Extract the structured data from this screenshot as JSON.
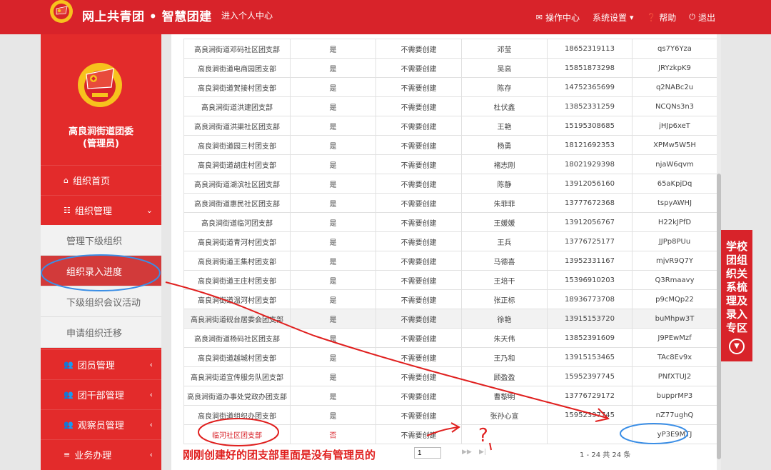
{
  "header": {
    "brand": "网上共青团 • 智慧团建",
    "enter_personal": "进入个人中心",
    "nav": {
      "operation_center": "操作中心",
      "system_settings": "系统设置",
      "help": "帮助",
      "logout": "退出"
    }
  },
  "sidebar": {
    "org_name_line1": "高良涧街道团委",
    "org_name_line2": "(管理员)",
    "items": {
      "home": "组织首页",
      "org_mgmt": "组织管理",
      "sub_manage": "管理下级组织",
      "sub_progress": "组织录入进度",
      "sub_meeting": "下级组织会议活动",
      "sub_migrate": "申请组织迁移",
      "member_mgmt": "团员管理",
      "cadre_mgmt": "团干部管理",
      "observer_mgmt": "观察员管理",
      "business": "业务办理"
    }
  },
  "table": {
    "rows": [
      {
        "org": "高良涧街道邓码社区团支部",
        "flag": "是",
        "status": "不需要创建",
        "name": "邓莹",
        "phone": "18652319113",
        "code": "qs7Y6Yza"
      },
      {
        "org": "高良涧街道电商园团支部",
        "flag": "是",
        "status": "不需要创建",
        "name": "吴高",
        "phone": "15851873298",
        "code": "JRYzkpK9"
      },
      {
        "org": "高良涧街道贺接村团支部",
        "flag": "是",
        "status": "不需要创建",
        "name": "陈存",
        "phone": "14752365699",
        "code": "q2NABc2u"
      },
      {
        "org": "高良涧街道洪建团支部",
        "flag": "是",
        "status": "不需要创建",
        "name": "杜伏鑫",
        "phone": "13852331259",
        "code": "NCQNs3n3"
      },
      {
        "org": "高良涧街道洪渠社区团支部",
        "flag": "是",
        "status": "不需要创建",
        "name": "王艳",
        "phone": "15195308685",
        "code": "jHJp6xeT"
      },
      {
        "org": "高良涧街道园三村团支部",
        "flag": "是",
        "status": "不需要创建",
        "name": "杨勇",
        "phone": "18121692353",
        "code": "XPMw5W5H"
      },
      {
        "org": "高良涧街道胡庄村团支部",
        "flag": "是",
        "status": "不需要创建",
        "name": "褚志刚",
        "phone": "18021929398",
        "code": "njaW6qvm"
      },
      {
        "org": "高良涧街道湖滨社区团支部",
        "flag": "是",
        "status": "不需要创建",
        "name": "陈静",
        "phone": "13912056160",
        "code": "65aKpjDq"
      },
      {
        "org": "高良涧街道惠民社区团支部",
        "flag": "是",
        "status": "不需要创建",
        "name": "朱菲菲",
        "phone": "13777672368",
        "code": "tspyAWHJ"
      },
      {
        "org": "高良涧街道临河团支部",
        "flag": "是",
        "status": "不需要创建",
        "name": "王媛媛",
        "phone": "13912056767",
        "code": "H22kJPfD"
      },
      {
        "org": "高良涧街道青河村团支部",
        "flag": "是",
        "status": "不需要创建",
        "name": "王兵",
        "phone": "13776725177",
        "code": "JJPp8PUu"
      },
      {
        "org": "高良涧街道王集村团支部",
        "flag": "是",
        "status": "不需要创建",
        "name": "马德喜",
        "phone": "13952331167",
        "code": "mjvR9Q7Y"
      },
      {
        "org": "高良涧街道王庄村团支部",
        "flag": "是",
        "status": "不需要创建",
        "name": "王培干",
        "phone": "15396910203",
        "code": "Q3Rmaavy"
      },
      {
        "org": "高良涧街道温河村团支部",
        "flag": "是",
        "status": "不需要创建",
        "name": "张正标",
        "phone": "18936773708",
        "code": "p9cMQp22"
      },
      {
        "org": "高良涧街道砚台居委会团支部",
        "flag": "是",
        "status": "不需要创建",
        "name": "徐艳",
        "phone": "13915153720",
        "code": "buMhpw3T"
      },
      {
        "org": "高良涧街道杨码社区团支部",
        "flag": "是",
        "status": "不需要创建",
        "name": "朱天伟",
        "phone": "13852391609",
        "code": "J9PEwMzf"
      },
      {
        "org": "高良涧街道越城村团支部",
        "flag": "是",
        "status": "不需要创建",
        "name": "王乃和",
        "phone": "13915153465",
        "code": "TAc8Ev9x"
      },
      {
        "org": "高良涧街道宣传服务队团支部",
        "flag": "是",
        "status": "不需要创建",
        "name": "顾盈盈",
        "phone": "15952397745",
        "code": "PNfXTUJ2"
      },
      {
        "org": "高良涧街道办事处党政办团支部",
        "flag": "是",
        "status": "不需要创建",
        "name": "曹黎明",
        "phone": "13776729172",
        "code": "bupprMP3"
      },
      {
        "org": "高良涧街道组织办团支部",
        "flag": "是",
        "status": "不需要创建",
        "name": "张孙心宣",
        "phone": "15952397745",
        "code": "nZ77ughQ"
      }
    ],
    "new_row": {
      "org": "临河社区团支部",
      "flag": "否",
      "status": "不需要创建",
      "name": "",
      "phone": "",
      "code": "yP3E9MTJ"
    }
  },
  "pager": {
    "page_value": "1",
    "summary": "1 - 24  共 24 条"
  },
  "special_panel": {
    "text": "学校团组织关系梳理及录入专区"
  },
  "annotation": {
    "caption": "刚刚创建好的团支部里面是没有管理员的",
    "question": "?"
  },
  "colors": {
    "brand_red": "#d8232a",
    "sidebar_red": "#e32b2b",
    "annotation_blue": "#3a8ee6"
  }
}
